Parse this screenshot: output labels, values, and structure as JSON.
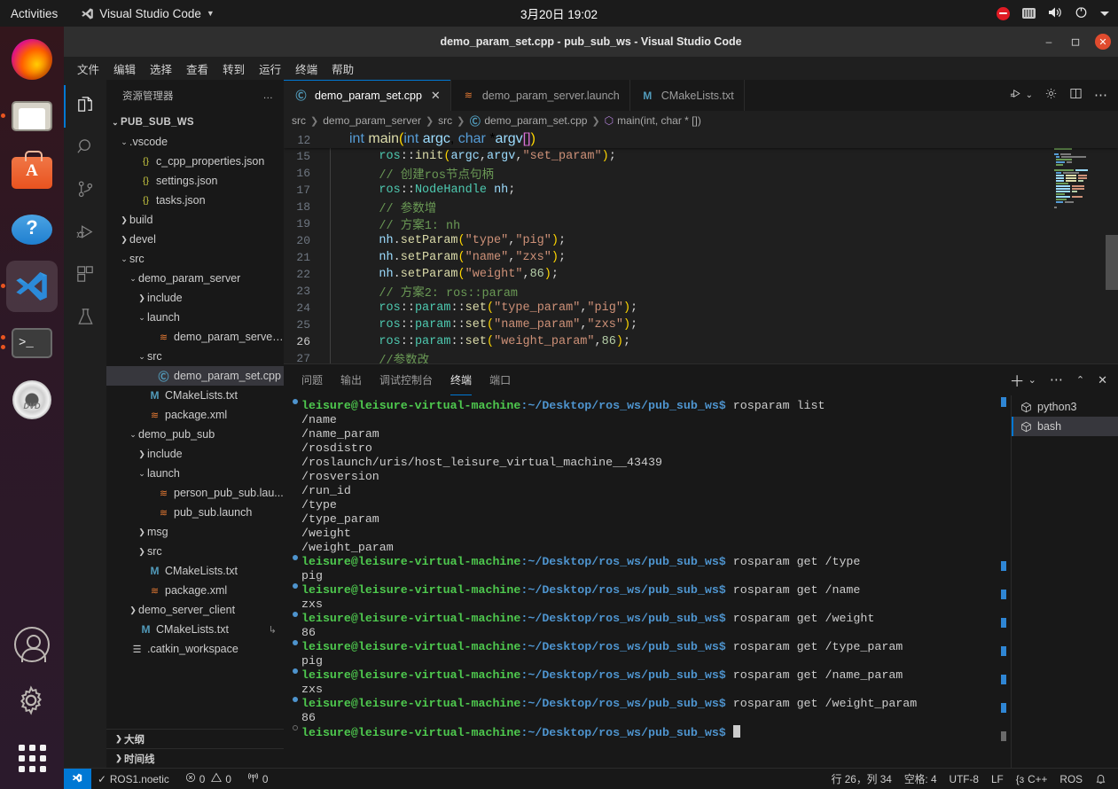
{
  "desktop": {
    "activities": "Activities",
    "app_name": "Visual Studio Code",
    "clock": "3月20日  19:02",
    "dock_items": [
      {
        "name": "firefox",
        "label": "Firefox"
      },
      {
        "name": "files",
        "label": "Files"
      },
      {
        "name": "software",
        "label": "Ubuntu Software"
      },
      {
        "name": "help",
        "label": "Help"
      },
      {
        "name": "vscode",
        "label": "Visual Studio Code"
      },
      {
        "name": "terminal",
        "label": "Terminal"
      },
      {
        "name": "dvd",
        "label": "DVD"
      }
    ],
    "tray": [
      "record-icon",
      "keyboard-icon",
      "volume-icon",
      "power-icon",
      "chevron-down-icon"
    ]
  },
  "window": {
    "title": "demo_param_set.cpp - pub_sub_ws - Visual Studio Code",
    "minimize": "–",
    "maximize": "❐",
    "close": "✕"
  },
  "menubar": [
    "文件",
    "编辑",
    "选择",
    "查看",
    "转到",
    "运行",
    "终端",
    "帮助"
  ],
  "activitybar": [
    {
      "name": "explorer",
      "icon": "files-icon",
      "active": true
    },
    {
      "name": "search",
      "icon": "search-icon",
      "active": false
    },
    {
      "name": "source-control",
      "icon": "source-control-icon",
      "active": false
    },
    {
      "name": "run-debug",
      "icon": "run-debug-icon",
      "active": false
    },
    {
      "name": "extensions",
      "icon": "extensions-icon",
      "active": false
    },
    {
      "name": "testing",
      "icon": "beaker-icon",
      "active": false
    }
  ],
  "activitybar_bottom": [
    {
      "name": "accounts",
      "icon": "account-icon"
    },
    {
      "name": "settings",
      "icon": "gear-icon"
    }
  ],
  "sidebar": {
    "title": "资源管理器",
    "more": "…",
    "tree": [
      {
        "label": "PUB_SUB_WS",
        "depth": 0,
        "twisty": "open",
        "icon": "",
        "root": true
      },
      {
        "label": ".vscode",
        "depth": 1,
        "twisty": "open",
        "icon": ""
      },
      {
        "label": "c_cpp_properties.json",
        "depth": 2,
        "twisty": "none",
        "icon": "json"
      },
      {
        "label": "settings.json",
        "depth": 2,
        "twisty": "none",
        "icon": "json"
      },
      {
        "label": "tasks.json",
        "depth": 2,
        "twisty": "none",
        "icon": "json"
      },
      {
        "label": "build",
        "depth": 1,
        "twisty": "closed",
        "icon": ""
      },
      {
        "label": "devel",
        "depth": 1,
        "twisty": "closed",
        "icon": ""
      },
      {
        "label": "src",
        "depth": 1,
        "twisty": "open",
        "icon": ""
      },
      {
        "label": "demo_param_server",
        "depth": 2,
        "twisty": "open",
        "icon": ""
      },
      {
        "label": "include",
        "depth": 3,
        "twisty": "closed",
        "icon": ""
      },
      {
        "label": "launch",
        "depth": 3,
        "twisty": "open",
        "icon": ""
      },
      {
        "label": "demo_param_server...",
        "depth": 4,
        "twisty": "none",
        "icon": "launch"
      },
      {
        "label": "src",
        "depth": 3,
        "twisty": "open",
        "icon": ""
      },
      {
        "label": "demo_param_set.cpp",
        "depth": 4,
        "twisty": "none",
        "icon": "cpp",
        "selected": true
      },
      {
        "label": "CMakeLists.txt",
        "depth": 3,
        "twisty": "none",
        "icon": "cmake"
      },
      {
        "label": "package.xml",
        "depth": 3,
        "twisty": "none",
        "icon": "launch"
      },
      {
        "label": "demo_pub_sub",
        "depth": 2,
        "twisty": "open",
        "icon": ""
      },
      {
        "label": "include",
        "depth": 3,
        "twisty": "closed",
        "icon": ""
      },
      {
        "label": "launch",
        "depth": 3,
        "twisty": "open",
        "icon": ""
      },
      {
        "label": "person_pub_sub.lau...",
        "depth": 4,
        "twisty": "none",
        "icon": "launch"
      },
      {
        "label": "pub_sub.launch",
        "depth": 4,
        "twisty": "none",
        "icon": "launch"
      },
      {
        "label": "msg",
        "depth": 3,
        "twisty": "closed",
        "icon": ""
      },
      {
        "label": "src",
        "depth": 3,
        "twisty": "closed",
        "icon": ""
      },
      {
        "label": "CMakeLists.txt",
        "depth": 3,
        "twisty": "none",
        "icon": "cmake"
      },
      {
        "label": "package.xml",
        "depth": 3,
        "twisty": "none",
        "icon": "launch"
      },
      {
        "label": "demo_server_client",
        "depth": 2,
        "twisty": "closed",
        "icon": ""
      },
      {
        "label": "CMakeLists.txt",
        "depth": 2,
        "twisty": "none",
        "icon": "cmake",
        "trailing": "↳"
      },
      {
        "label": ".catkin_workspace",
        "depth": 1,
        "twisty": "none",
        "icon": "txtfile"
      }
    ],
    "sections": [
      "大纲",
      "时间线"
    ]
  },
  "tabs": [
    {
      "label": "demo_param_set.cpp",
      "icon": "cpp",
      "active": true,
      "close": "✕"
    },
    {
      "label": "demo_param_server.launch",
      "icon": "launch",
      "active": false
    },
    {
      "label": "CMakeLists.txt",
      "icon": "cmake",
      "active": false
    }
  ],
  "tabs_actions": [
    "run-icon",
    "chevron-down-icon",
    "gear-icon",
    "split-editor-icon",
    "more-icon"
  ],
  "breadcrumb": [
    "src",
    "demo_param_server",
    "src",
    "demo_param_set.cpp",
    "main(int, char * [])"
  ],
  "editor": {
    "sticky_line": {
      "num": "12",
      "text": "int main(int argc, char *argv[])"
    },
    "lines": [
      {
        "num": "15",
        "text": "    ros::init(argc,argv,\"set_param\");"
      },
      {
        "num": "16",
        "text": "    // 创建ros节点句柄"
      },
      {
        "num": "17",
        "text": "    ros::NodeHandle nh;"
      },
      {
        "num": "18",
        "text": "    // 参数增"
      },
      {
        "num": "19",
        "text": "    // 方案1: nh"
      },
      {
        "num": "20",
        "text": "    nh.setParam(\"type\",\"pig\");"
      },
      {
        "num": "21",
        "text": "    nh.setParam(\"name\",\"zxs\");"
      },
      {
        "num": "22",
        "text": "    nh.setParam(\"weight\",86);"
      },
      {
        "num": "23",
        "text": "    // 方案2: ros::param"
      },
      {
        "num": "24",
        "text": "    ros::param::set(\"type_param\",\"pig\");"
      },
      {
        "num": "25",
        "text": "    ros::param::set(\"name_param\",\"zxs\");"
      },
      {
        "num": "26",
        "text": "    ros::param::set(\"weight_param\",86);"
      },
      {
        "num": "27",
        "text": "    //参数改"
      }
    ]
  },
  "panel": {
    "tabs": [
      {
        "label": "问题",
        "active": false
      },
      {
        "label": "输出",
        "active": false
      },
      {
        "label": "调试控制台",
        "active": false
      },
      {
        "label": "终端",
        "active": true
      },
      {
        "label": "端口",
        "active": false
      }
    ],
    "actions": [
      "add-terminal-icon",
      "chevron-down-icon",
      "more-icon",
      "maximize-panel-icon",
      "close-panel-icon"
    ],
    "terminal_sidebar": [
      {
        "label": "python3",
        "active": false
      },
      {
        "label": "bash",
        "active": true
      }
    ],
    "prompt_user": "leisure@leisure-virtual-machine",
    "prompt_path": ":~/Desktop/ros_ws/pub_sub_ws$ ",
    "terminal_lines": [
      {
        "type": "cmd",
        "cmd": "rosparam list"
      },
      {
        "type": "out",
        "text": "/name"
      },
      {
        "type": "out",
        "text": "/name_param"
      },
      {
        "type": "out",
        "text": "/rosdistro"
      },
      {
        "type": "out",
        "text": "/roslaunch/uris/host_leisure_virtual_machine__43439"
      },
      {
        "type": "out",
        "text": "/rosversion"
      },
      {
        "type": "out",
        "text": "/run_id"
      },
      {
        "type": "out",
        "text": "/type"
      },
      {
        "type": "out",
        "text": "/type_param"
      },
      {
        "type": "out",
        "text": "/weight"
      },
      {
        "type": "out",
        "text": "/weight_param"
      },
      {
        "type": "cmd",
        "cmd": "rosparam get /type"
      },
      {
        "type": "out",
        "text": "pig"
      },
      {
        "type": "cmd",
        "cmd": "rosparam get /name"
      },
      {
        "type": "out",
        "text": "zxs"
      },
      {
        "type": "cmd",
        "cmd": "rosparam get /weight"
      },
      {
        "type": "out",
        "text": "86"
      },
      {
        "type": "cmd",
        "cmd": "rosparam get /type_param"
      },
      {
        "type": "out",
        "text": "pig"
      },
      {
        "type": "cmd",
        "cmd": "rosparam get /name_param"
      },
      {
        "type": "out",
        "text": "zxs"
      },
      {
        "type": "cmd",
        "cmd": "rosparam get /weight_param"
      },
      {
        "type": "out",
        "text": "86"
      },
      {
        "type": "prompt",
        "cmd": ""
      }
    ]
  },
  "statusbar": {
    "remote_icon": "remote-window-icon",
    "ros_distro": "ROS1.noetic",
    "errors": "0",
    "warnings": "0",
    "radio": "0",
    "cursor": "行 26，列 34",
    "indent": "空格: 4",
    "encoding": "UTF-8",
    "eol": "LF",
    "language": "C++",
    "ros": "ROS",
    "bell": "notifications-icon"
  },
  "colors": {
    "accent": "#0078d4",
    "ubuntu_orange": "#e95420",
    "close_red": "#e04b2e",
    "terminal_green": "#4ec94e",
    "terminal_blue": "#4e94ce"
  }
}
